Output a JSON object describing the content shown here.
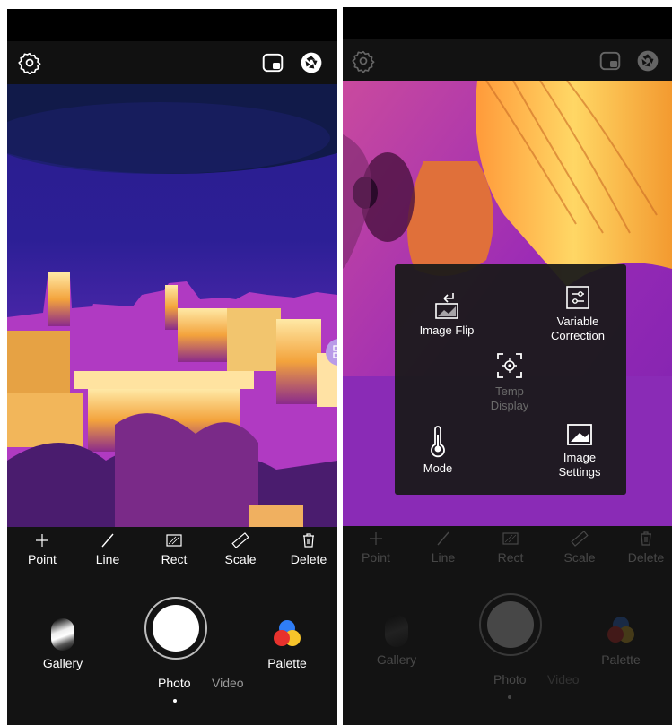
{
  "screens": [
    {
      "id": "left",
      "tools": [
        {
          "label": "Point",
          "icon": "point-icon"
        },
        {
          "label": "Line",
          "icon": "line-icon"
        },
        {
          "label": "Rect",
          "icon": "rect-icon"
        },
        {
          "label": "Scale",
          "icon": "ruler-icon"
        },
        {
          "label": "Delete",
          "icon": "trash-icon"
        }
      ],
      "gallery_label": "Gallery",
      "palette_label": "Palette",
      "modes": [
        "Photo",
        "Video"
      ],
      "active_mode": "Photo"
    },
    {
      "id": "right",
      "tools": [
        {
          "label": "Point",
          "icon": "point-icon"
        },
        {
          "label": "Line",
          "icon": "line-icon"
        },
        {
          "label": "Rect",
          "icon": "rect-icon"
        },
        {
          "label": "Scale",
          "icon": "ruler-icon"
        },
        {
          "label": "Delete",
          "icon": "trash-icon"
        }
      ],
      "gallery_label": "Gallery",
      "palette_label": "Palette",
      "modes": [
        "Photo",
        "Video"
      ],
      "active_mode": "Photo",
      "menu": {
        "image_flip": "Image Flip",
        "variable_correction": [
          "Variable",
          "Correction"
        ],
        "temp_display": [
          "Temp",
          "Display"
        ],
        "mode": "Mode",
        "image_settings": [
          "Image",
          "Settings"
        ]
      }
    }
  ],
  "icons": {
    "settings": "gear-icon",
    "picture_in_picture": "pip-icon",
    "camera_switch": "aperture-icon"
  },
  "colors": {
    "background": "#131313",
    "shutter": "#ffffff",
    "thermal_cold": "#2a1a8a",
    "thermal_hot": "#ffd35a"
  }
}
